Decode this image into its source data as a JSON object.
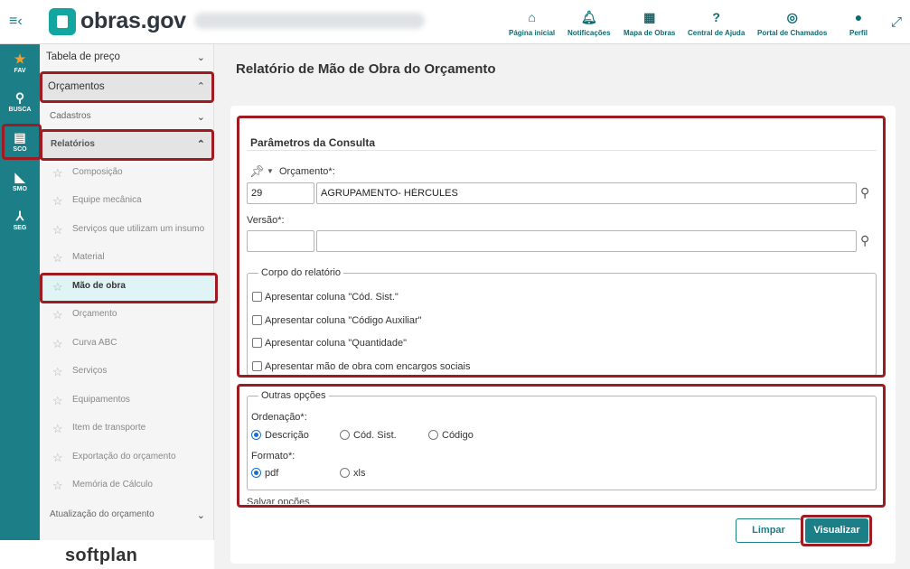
{
  "header": {
    "menu_icon": "menu-collapse-icon",
    "logo_text": "obras.gov",
    "nav": [
      {
        "label": "Página inicial",
        "icon": "home-icon"
      },
      {
        "label": "Notificações",
        "icon": "bell-icon"
      },
      {
        "label": "Mapa de Obras",
        "icon": "map-icon"
      },
      {
        "label": "Central de Ajuda",
        "icon": "help-icon"
      },
      {
        "label": "Portal de Chamados",
        "icon": "lifebuoy-icon"
      },
      {
        "label": "Perfil",
        "icon": "user-icon"
      }
    ],
    "expand_icon": "expand-icon"
  },
  "rail": {
    "items": [
      {
        "label": "FAV",
        "icon": "star-icon"
      },
      {
        "label": "BUSCA",
        "icon": "search-icon"
      },
      {
        "label": "SCO",
        "icon": "sco-icon"
      },
      {
        "label": "SMO",
        "icon": "ruler-icon"
      },
      {
        "label": "SEG",
        "icon": "merge-icon"
      }
    ]
  },
  "sidebar": {
    "top_item": "Tabela de preço",
    "orcamentos": "Orçamentos",
    "cadastros": "Cadastros",
    "relatorios": "Relatórios",
    "reports": [
      "Composição",
      "Equipe mecânica",
      "Serviços que utilizam um insumo",
      "Material",
      "Mão de obra",
      "Orçamento",
      "Curva ABC",
      "Serviços",
      "Equipamentos",
      "Item de transporte",
      "Exportação do orçamento",
      "Memória de Cálculo"
    ],
    "atualizacao": "Atualização do orçamento"
  },
  "footer": {
    "brand": "softplan"
  },
  "main": {
    "title": "Relatório de Mão de Obra do Orçamento",
    "section_title": "Parâmetros da Consulta",
    "orcamento_label": "Orçamento*:",
    "orcamento_code": "29",
    "orcamento_name": "AGRUPAMENTO- HÉRCULES",
    "versao_label": "Versão*:",
    "versao_code": "",
    "versao_name": "",
    "corpo_legend": "Corpo do relatório",
    "checkboxes": [
      "Apresentar coluna \"Cód. Sist.\"",
      "Apresentar coluna \"Código Auxiliar\"",
      "Apresentar coluna \"Quantidade\"",
      "Apresentar mão de obra com encargos sociais"
    ],
    "outras_legend": "Outras opções",
    "ordenacao_label": "Ordenação*:",
    "ordenacao_options": [
      "Descrição",
      "Cód. Sist.",
      "Código"
    ],
    "ordenacao_selected": "Descrição",
    "formato_label": "Formato*:",
    "formato_options": [
      "pdf",
      "xls"
    ],
    "formato_selected": "pdf",
    "salvar_label": "Salvar opções",
    "btn_limpar": "Limpar",
    "btn_visualizar": "Visualizar"
  },
  "colors": {
    "accent": "#1c7e87",
    "highlight": "#9e1b22",
    "radio_selected": "#1a6fd1"
  }
}
